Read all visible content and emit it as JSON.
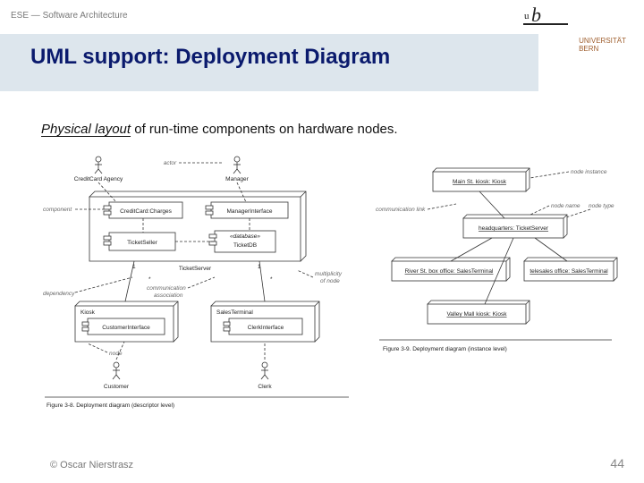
{
  "header": {
    "breadcrumb": "ESE — Software Architecture",
    "logo": {
      "u": "u",
      "b": "b"
    },
    "university_line1": "UNIVERSITÄT",
    "university_line2": "BERN"
  },
  "title": "UML support: Deployment Diagram",
  "subtitle": {
    "emph": "Physical layout",
    "rest": " of run-time components on hardware nodes."
  },
  "fig_left": {
    "actor_agency": "CreditCard Agency",
    "actor_manager": "Manager",
    "label_actor": "actor",
    "label_component": "component",
    "comp_charges": "CreditCard:Charges",
    "comp_manager_if": "ManagerInterface",
    "comp_seller": "TicketSeller",
    "db_label": "«database»",
    "db_name": "TicketDB",
    "node_ticketserver": "TicketServer",
    "label_dependency": "dependency",
    "label_comm_assoc": "communication\nassociation",
    "label_multiplicity": "multiplicity\nof node",
    "label_node": "node",
    "node_kiosk": "Kiosk",
    "comp_custif": "CustomerInterface",
    "node_sales": "SalesTerminal",
    "comp_clerkif": "ClerkInterface",
    "actor_customer": "Customer",
    "actor_clerk": "Clerk",
    "caption": "Figure 3-8. Deployment diagram (descriptor level)"
  },
  "fig_right": {
    "label_node_instance": "node instance",
    "label_comm_link": "communication link",
    "label_node_name": "node name",
    "label_node_type": "node type",
    "n1": "Main St. kiosk: Kiosk",
    "n2": "headquarters: TicketServer",
    "n3": "River St. box office: SalesTerminal",
    "n4": "telesales office: SalesTerminal",
    "n5": "Valley Mall kiosk: Kiosk",
    "caption": "Figure 3-9. Deployment diagram (instance level)"
  },
  "footer": {
    "author": "© Oscar Nierstrasz",
    "page": "44"
  }
}
